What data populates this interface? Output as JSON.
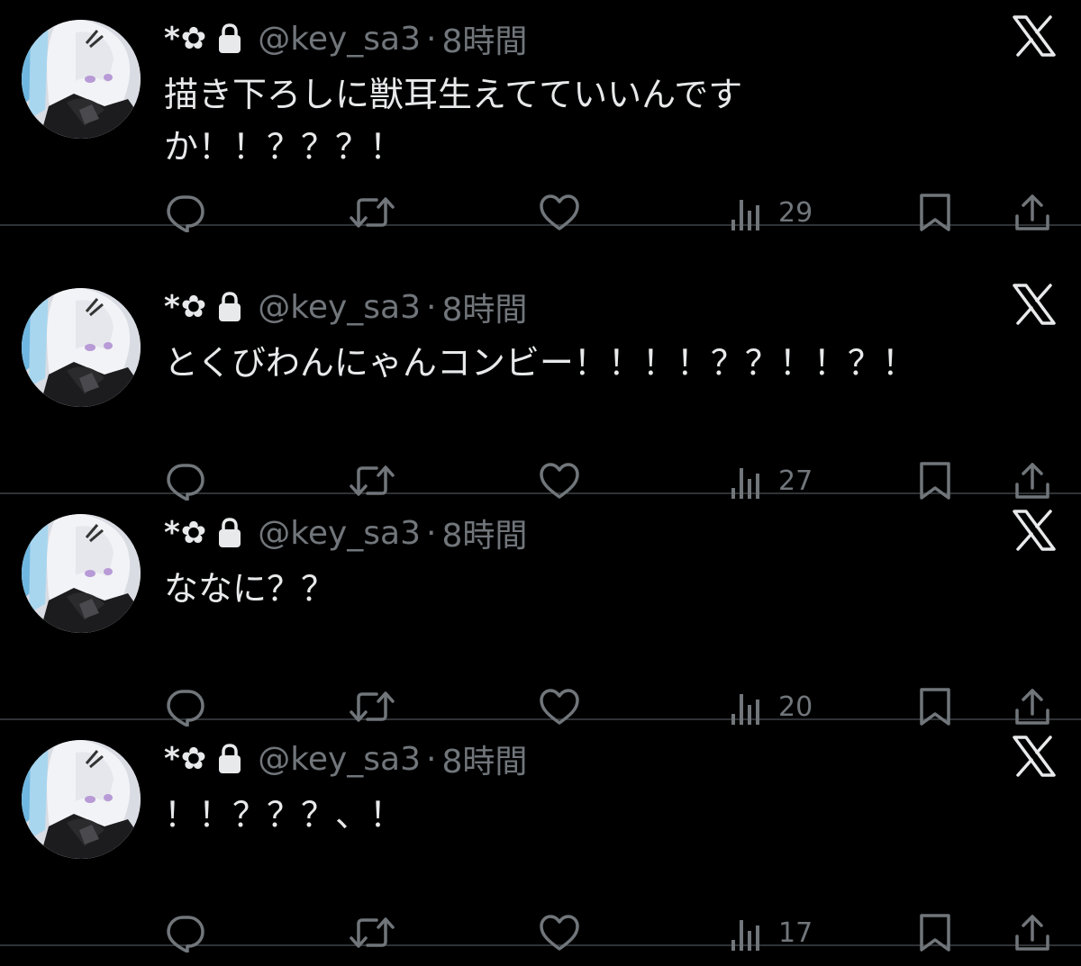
{
  "colors": {
    "background": "#000000",
    "text_primary": "#e7e9ea",
    "text_secondary": "#71767b",
    "divider": "#2f3336"
  },
  "tweets": [
    {
      "display_name": "*✿",
      "handle": "@key_sa3",
      "separator": "·",
      "time": "8時間",
      "text": "描き下ろしに獣耳生えてていいんです\nか！！？？？！",
      "views": "29"
    },
    {
      "display_name": "*✿",
      "handle": "@key_sa3",
      "separator": "·",
      "time": "8時間",
      "text": "とくびわんにゃんコンビー！！！！？？！！？！",
      "views": "27"
    },
    {
      "display_name": "*✿",
      "handle": "@key_sa3",
      "separator": "·",
      "time": "8時間",
      "text": "ななに？？",
      "views": "20"
    },
    {
      "display_name": "*✿",
      "handle": "@key_sa3",
      "separator": "·",
      "time": "8時間",
      "text": "！！？？？、！",
      "views": "17"
    }
  ],
  "icons": {
    "lock": "lock-icon",
    "brand": "x-logo-icon",
    "reply": "reply-icon",
    "retweet": "retweet-icon",
    "like": "like-icon",
    "views": "views-icon",
    "bookmark": "bookmark-icon",
    "share": "share-icon"
  }
}
